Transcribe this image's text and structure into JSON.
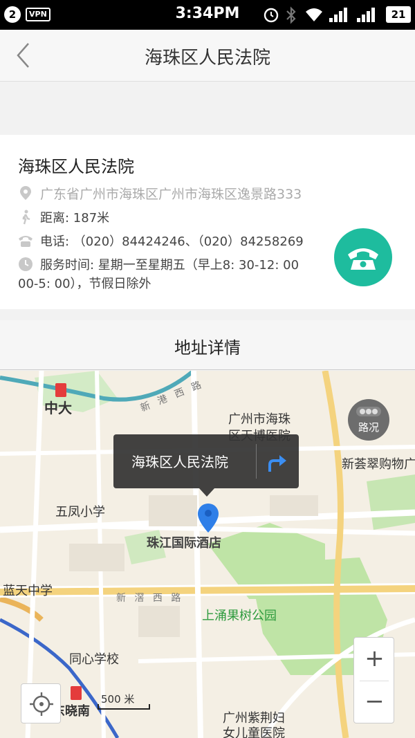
{
  "status_bar": {
    "notification_count": "2",
    "vpn": "VPN",
    "time": "3:34PM",
    "battery": "21"
  },
  "header": {
    "title": "海珠区人民法院",
    "back_icon": "chevron-left-icon"
  },
  "place": {
    "name": "海珠区人民法院",
    "address": "广东省广州市海珠区广州市海珠区逸景路333",
    "distance": "距离: 187米",
    "phone": "电话: （020）84424246、（020）84258269",
    "hours_line1": "服务时间: 星期一至星期五（早上8: 30-12: 00",
    "hours_line2": "00-5: 00），节假日除外",
    "call_icon": "phone-icon",
    "accent_color": "#1ebc9e"
  },
  "address_detail": {
    "label": "地址详情"
  },
  "map": {
    "popup_title": "海珠区人民法院",
    "popup_route_icon": "route-turn-icon",
    "traffic_label": "路况",
    "scale_label": "500 米",
    "zoom_in": "+",
    "zoom_out": "−",
    "labels": {
      "zhongda": "中大",
      "hospital_line1": "广州市海珠",
      "hospital_line2": "区天博医院",
      "mall": "新荟翠购物广",
      "wufeng": "五凤小学",
      "hotel": "珠江国际酒店",
      "lantian": "蓝天中学",
      "road_xinjiao": "新 滘 西 路",
      "road_xingang": "新 港 西 路",
      "park": "上涌果树公园",
      "tongxin": "同心学校",
      "dongxiaonan": "东晓南",
      "zijing_line1": "广州紫荆妇",
      "zijing_line2": "女儿童医院"
    }
  }
}
